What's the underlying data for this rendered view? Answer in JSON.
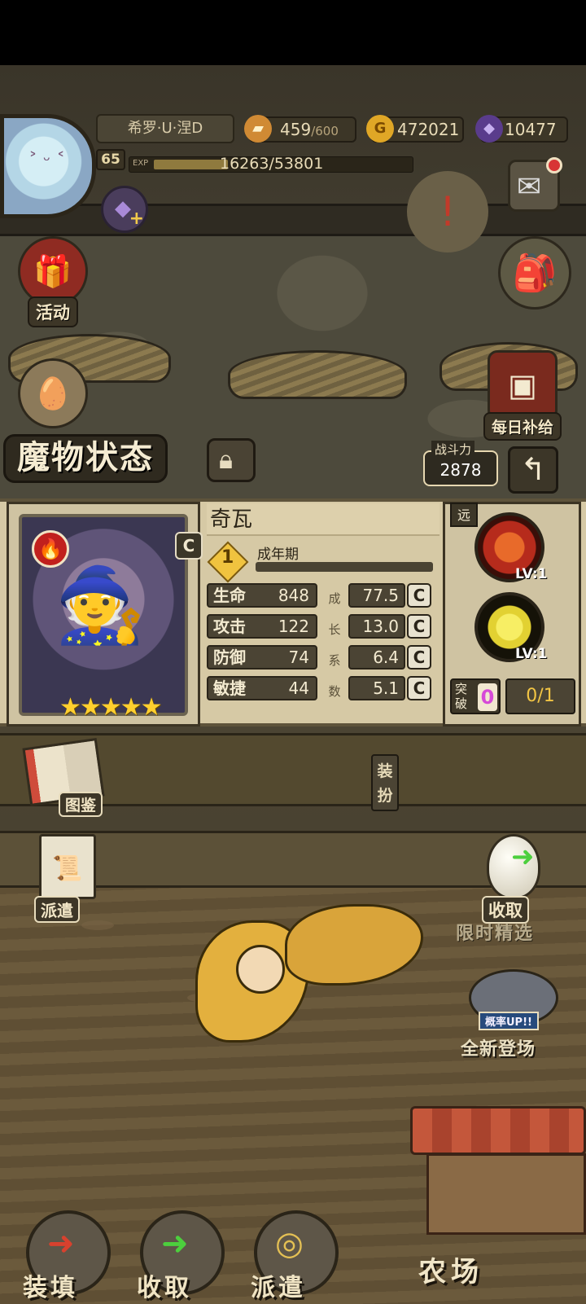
{
  "player": {
    "name": "希罗·U·涅D",
    "level": "65",
    "exp_label": "EXP",
    "exp_text": "16263/53801",
    "exp_fraction": 0.302
  },
  "resources": {
    "stamina_current": "459",
    "stamina_max": "/600",
    "gold": "472021",
    "gems": "10477"
  },
  "side_buttons": {
    "activity": "活动",
    "daily_supply": "每日补给"
  },
  "icons": {
    "bread": "bread-icon",
    "gold": "gold-coin-icon",
    "gem": "purple-gem-icon",
    "mail": "mail-icon",
    "lock": "lock-icon",
    "back": "back-arrow-icon",
    "fire": "fire-element-icon"
  },
  "monster_status": {
    "title": "魔物状态",
    "power_label": "战斗力",
    "power_value": "2878",
    "name": "奇瓦",
    "rank": "C",
    "stage_number": "1",
    "stage_text": "成年期",
    "stars": "★★★★★",
    "growth_label": [
      "成",
      "长",
      "系",
      "数"
    ],
    "stats": [
      {
        "label": "生命",
        "value": "848",
        "growth": "77.5",
        "grade": "C"
      },
      {
        "label": "攻击",
        "value": "122",
        "growth": "13.0",
        "grade": "C"
      },
      {
        "label": "防御",
        "value": "74",
        "growth": "6.4",
        "grade": "C"
      },
      {
        "label": "敏捷",
        "value": "44",
        "growth": "5.1",
        "grade": "C"
      }
    ],
    "range_tag": "远",
    "skills": [
      {
        "level": "LV:1",
        "color": "#b62b1c"
      },
      {
        "level": "LV:1",
        "color": "#e2d132"
      }
    ],
    "breakthrough_label": "突破",
    "breakthrough_value": "0",
    "breakthrough_count": "0/1"
  },
  "actions": {
    "codex": "图鉴",
    "equip": "装扮",
    "dispatch": "派遣",
    "harvest": "收取",
    "limited_pick": "限时精选",
    "rate_up": "概率UP!!",
    "new_arrival": "全新登场",
    "farm": "农场"
  },
  "bottom_nav": [
    {
      "label": "装填",
      "glyph": "➜",
      "glyph_color": "#d8412e"
    },
    {
      "label": "收取",
      "glyph": "➜",
      "glyph_color": "#4ccf3d"
    },
    {
      "label": "派遣",
      "glyph": "◎",
      "glyph_color": "#e4c054"
    }
  ],
  "colors": {
    "accent_gold": "#f2c544",
    "fire_red": "#c1201d",
    "panel_bg": "#d6c9a5"
  }
}
